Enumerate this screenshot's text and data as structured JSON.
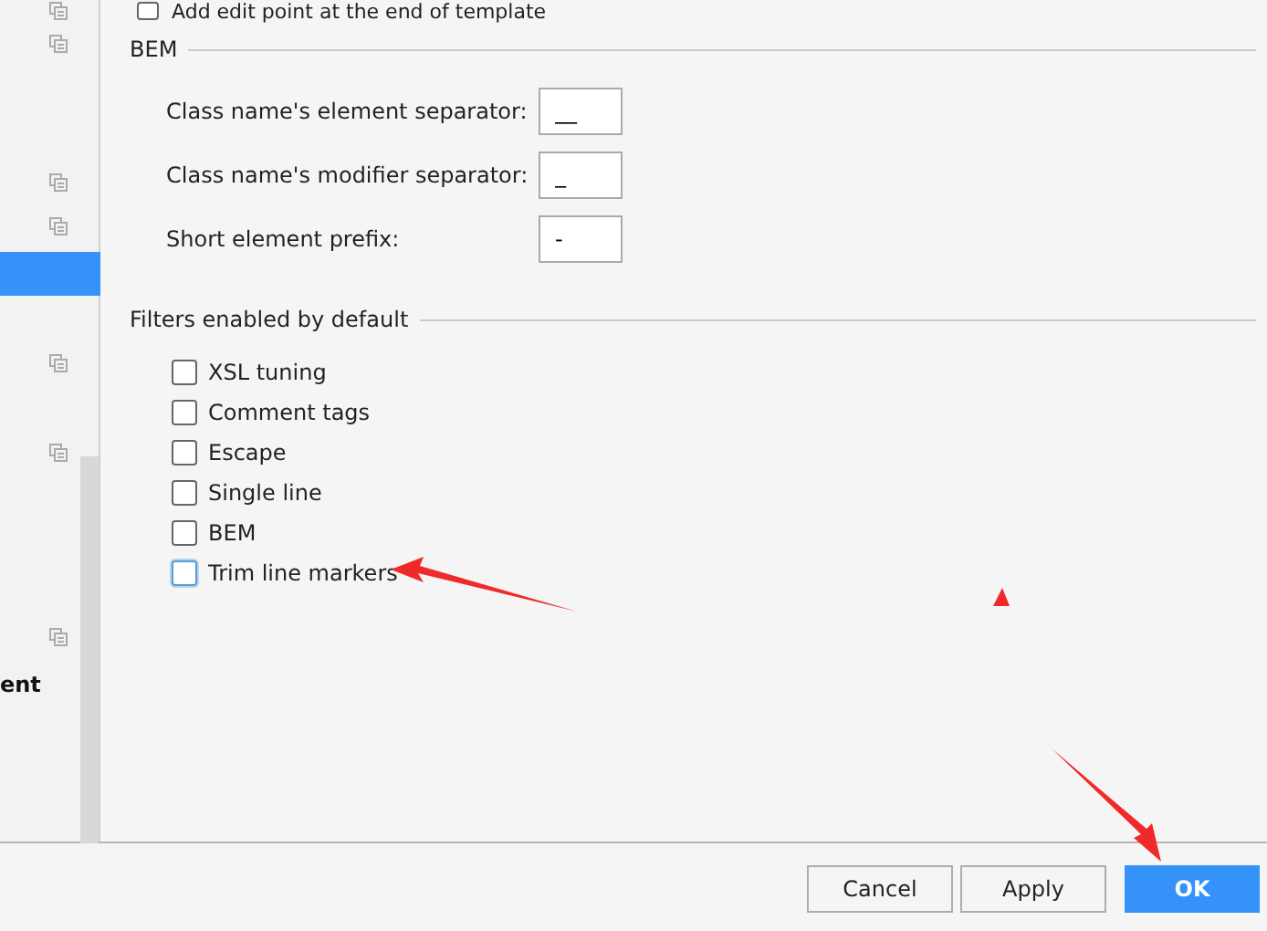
{
  "sidebar": {
    "items": [
      {
        "kind": "icon",
        "selected": false
      },
      {
        "kind": "icon",
        "selected": false
      },
      {
        "kind": "icon",
        "selected": false
      },
      {
        "kind": "icon",
        "selected": false
      },
      {
        "kind": "blank",
        "selected": true
      },
      {
        "kind": "icon",
        "selected": false
      },
      {
        "kind": "icon",
        "selected": false
      },
      {
        "kind": "icon",
        "selected": false
      },
      {
        "kind": "text",
        "label": "ent",
        "selected": false
      }
    ]
  },
  "top_option": {
    "label": "Add edit point at the end of template",
    "checked": false
  },
  "bem": {
    "title": "BEM",
    "fields": [
      {
        "label": "Class name's element separator:",
        "value": "__"
      },
      {
        "label": "Class name's modifier separator:",
        "value": "_"
      },
      {
        "label": "Short element prefix:",
        "value": "-"
      }
    ]
  },
  "filters": {
    "title": "Filters enabled by default",
    "items": [
      {
        "label": "XSL tuning",
        "checked": false,
        "focused": false
      },
      {
        "label": "Comment tags",
        "checked": false,
        "focused": false
      },
      {
        "label": "Escape",
        "checked": false,
        "focused": false
      },
      {
        "label": "Single line",
        "checked": false,
        "focused": false
      },
      {
        "label": "BEM",
        "checked": false,
        "focused": false
      },
      {
        "label": "Trim line markers",
        "checked": false,
        "focused": true
      }
    ]
  },
  "buttons": [
    {
      "label": "Cancel",
      "kind": "normal"
    },
    {
      "label": "Apply",
      "kind": "normal"
    },
    {
      "label": "OK",
      "kind": "default"
    }
  ]
}
